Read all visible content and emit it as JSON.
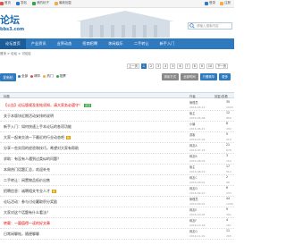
{
  "topbar": {
    "links": [
      {
        "label": "首页",
        "color": "#d9534f"
      },
      {
        "label": "发帖",
        "color": "#2f79bf"
      },
      {
        "label": "我的帖子",
        "color": "#3aa34a"
      },
      {
        "label": "最新回复",
        "color": "#f0ad4e"
      }
    ],
    "right": [
      {
        "label": "登录",
        "color": "#2f79bf"
      },
      {
        "label": "注册",
        "color": "#f0ad4e"
      }
    ]
  },
  "logo": {
    "main": "论坛",
    "sub": "bbs3.com"
  },
  "search": {
    "placeholder": "请输入搜索内容"
  },
  "nav": {
    "items": [
      "论坛首页",
      "产业资讯",
      "业界动态",
      "招商招聘",
      "休闲娱乐",
      "二手转让",
      "新手入门"
    ],
    "active": 0
  },
  "breadcrumb": "首页 > 论坛 > 讨论区",
  "pager": {
    "prev": "上一页",
    "pages": [
      "1",
      "2",
      "3",
      "4",
      "5",
      "6",
      "7",
      "8",
      "9",
      "10"
    ],
    "current": 0,
    "next": "下一页"
  },
  "actions": {
    "new_post": "发新帖",
    "filters": [
      {
        "label": "全部",
        "color": "#2f79bf"
      },
      {
        "label": "精华",
        "color": "#d9534f"
      },
      {
        "label": "热门",
        "color": "#f0ad4e"
      },
      {
        "label": "投票",
        "color": "#3aa34a"
      }
    ],
    "right": [
      {
        "label": "排序方式",
        "style": "gray"
      },
      {
        "label": "全部时间",
        "style": "gray"
      },
      {
        "label": "只看精华",
        "style": "blue"
      },
      {
        "label": "更多",
        "style": "blue"
      }
    ]
  },
  "table": {
    "headers": {
      "title": "标题",
      "author": "作者",
      "stats": "回复/查看"
    },
    "rows": [
      {
        "title": "【公告】论坛版规及发帖须知，请大家务必遵守！",
        "author": "管理员",
        "date": "2016-03-12",
        "replies": "35",
        "views": "1024",
        "badge": "置顶",
        "red": true
      },
      {
        "title": "关于本版块近期活动安排的说明",
        "author": "版主",
        "date": "2016-05-08",
        "replies": "12",
        "views": "856",
        "badge": "",
        "red": false
      },
      {
        "title": "新手入门：如何快速上手本论坛的各项功能",
        "author": "小编",
        "date": "2016-06-21",
        "replies": "8",
        "views": "432",
        "badge": "",
        "red": false
      },
      {
        "title": "大家一起来交流一下最近的行业动态吧",
        "author": "游客",
        "date": "2016-07-02",
        "replies": "5",
        "views": "210",
        "badge": "新",
        "red": false
      },
      {
        "title": "分享一些实用的经验和技巧，希望对大家有帮助",
        "author": "网友A",
        "date": "2016-07-15",
        "replies": "21",
        "views": "678",
        "badge": "",
        "red": false
      },
      {
        "title": "求助：有没有人遇到过类似的问题？",
        "author": "网友B",
        "date": "2016-08-03",
        "replies": "3",
        "views": "154",
        "badge": "",
        "red": false
      },
      {
        "title": "本周热门话题汇总，欢迎补充",
        "author": "版主",
        "date": "2016-08-19",
        "replies": "17",
        "views": "512",
        "badge": "",
        "red": false
      },
      {
        "title": "二手转让：闲置物品低价出售",
        "author": "网友C",
        "date": "2016-09-01",
        "replies": "2",
        "views": "98",
        "badge": "",
        "red": false
      },
      {
        "title": "招聘信息：诚聘相关专业人才",
        "author": "网友D",
        "date": "2016-09-10",
        "replies": "6",
        "views": "233",
        "badge": "新",
        "red": false
      },
      {
        "title": "论坛活动：参与讨论赢取积分奖励",
        "author": "管理员",
        "date": "2016-09-22",
        "replies": "44",
        "views": "1290",
        "badge": "",
        "red": false
      },
      {
        "title": "大家对这个话题有什么看法？",
        "author": "网友E",
        "date": "2016-10-05",
        "replies": "9",
        "views": "301",
        "badge": "",
        "red": false
      },
      {
        "title": "转载：一篇值得一读的好文章",
        "author": "网友F",
        "date": "2016-10-18",
        "replies": "4",
        "views": "187",
        "badge": "",
        "red": true
      },
      {
        "title": "日常闲聊帖，随便聊聊",
        "author": "网友G",
        "date": "2016-11-01",
        "replies": "11",
        "views": "265",
        "badge": "",
        "red": false
      }
    ]
  }
}
